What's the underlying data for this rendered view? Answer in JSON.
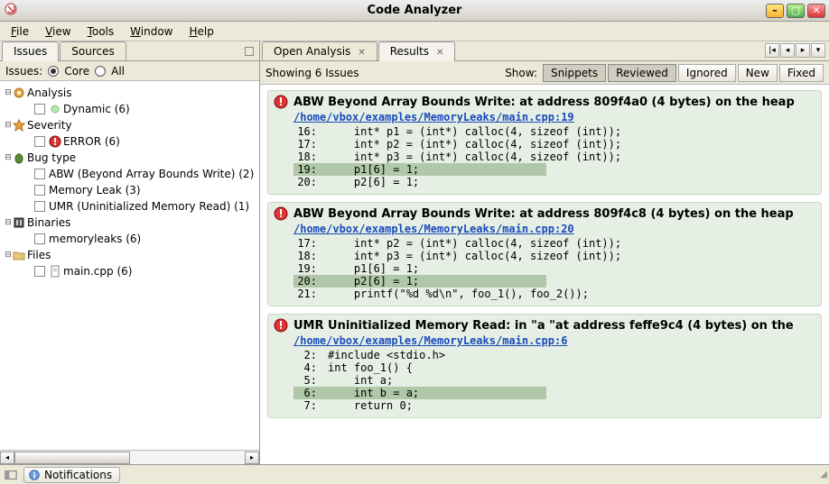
{
  "window": {
    "title": "Code Analyzer"
  },
  "menu": [
    "File",
    "View",
    "Tools",
    "Window",
    "Help"
  ],
  "left": {
    "tabs": [
      "Issues",
      "Sources"
    ],
    "ctrl_label": "Issues:",
    "radio_core": "Core",
    "radio_all": "All",
    "tree": [
      {
        "label": "Analysis",
        "icon": "gear",
        "expand": true,
        "children": [
          {
            "label": "Dynamic  (6)",
            "icon": "dot-green"
          }
        ]
      },
      {
        "label": "Severity",
        "icon": "star",
        "expand": true,
        "children": [
          {
            "label": "ERROR  (6)",
            "icon": "err"
          }
        ]
      },
      {
        "label": "Bug type",
        "icon": "bug",
        "expand": true,
        "children": [
          {
            "label": "ABW (Beyond Array Bounds Write)  (2)"
          },
          {
            "label": "Memory Leak  (3)"
          },
          {
            "label": "UMR (Uninitialized Memory Read)  (1)"
          }
        ]
      },
      {
        "label": "Binaries",
        "icon": "bins",
        "expand": true,
        "children": [
          {
            "label": "memoryleaks  (6)"
          }
        ]
      },
      {
        "label": "Files",
        "icon": "folder",
        "expand": true,
        "children": [
          {
            "label": "main.cpp  (6)",
            "icon": "file"
          }
        ]
      }
    ]
  },
  "right": {
    "tabs": [
      {
        "label": "Open Analysis",
        "closable": true,
        "active": false
      },
      {
        "label": "Results",
        "closable": true,
        "active": true
      }
    ],
    "count_text": "Showing 6 Issues",
    "show_label": "Show:",
    "filters": [
      {
        "label": "Snippets",
        "active": true
      },
      {
        "label": "Reviewed",
        "active": true
      },
      {
        "label": "Ignored",
        "active": false
      },
      {
        "label": "New",
        "active": false
      },
      {
        "label": "Fixed",
        "active": false
      }
    ],
    "issues": [
      {
        "title": "ABW Beyond Array Bounds Write: at address 809f4a0 (4 bytes) on the heap",
        "link": "/home/vbox/examples/MemoryLeaks/main.cpp:19",
        "lines": [
          {
            "n": "16:",
            "t": "int* p1 = (int*) calloc(4, sizeof (int));"
          },
          {
            "n": "17:",
            "t": "int* p2 = (int*) calloc(4, sizeof (int));"
          },
          {
            "n": "18:",
            "t": "int* p3 = (int*) calloc(4, sizeof (int));"
          },
          {
            "n": "19:",
            "t": "p1[6] = 1;",
            "hl": true
          },
          {
            "n": "20:",
            "t": "p2[6] = 1;"
          }
        ]
      },
      {
        "title": "ABW Beyond Array Bounds Write: at address 809f4c8 (4 bytes) on the heap",
        "link": "/home/vbox/examples/MemoryLeaks/main.cpp:20",
        "lines": [
          {
            "n": "17:",
            "t": "int* p2 = (int*) calloc(4, sizeof (int));"
          },
          {
            "n": "18:",
            "t": "int* p3 = (int*) calloc(4, sizeof (int));"
          },
          {
            "n": "19:",
            "t": "p1[6] = 1;"
          },
          {
            "n": "20:",
            "t": "p2[6] = 1;",
            "hl": true
          },
          {
            "n": "21:",
            "t": "printf(\"%d %d\\n\", foo_1(), foo_2());"
          }
        ]
      },
      {
        "title": "UMR Uninitialized Memory Read: in \"a \"at address feffe9c4 (4 bytes) on the",
        "link": "/home/vbox/examples/MemoryLeaks/main.cpp:6",
        "raw": true,
        "lines": [
          {
            "n": "2:",
            "t": "#include <stdio.h>",
            "noindent": true
          },
          {
            "n": "4:",
            "t": "int foo_1() {",
            "noindent": true
          },
          {
            "n": "5:",
            "t": "int a;"
          },
          {
            "n": "6:",
            "t": "int b = a;",
            "hl": true
          },
          {
            "n": "7:",
            "t": "return 0;"
          }
        ]
      }
    ]
  },
  "status": {
    "notifications": "Notifications"
  }
}
